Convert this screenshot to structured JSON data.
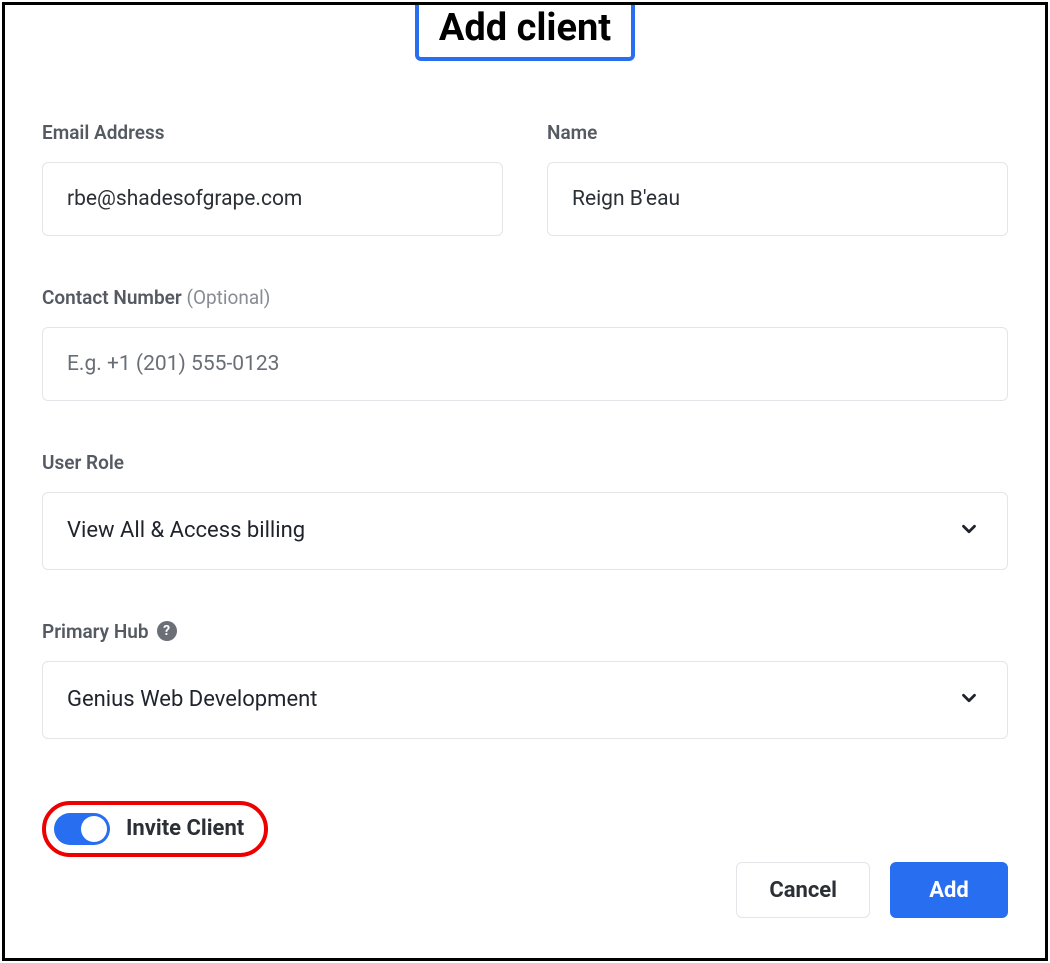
{
  "dialog": {
    "title": "Add client"
  },
  "fields": {
    "email": {
      "label": "Email Address",
      "value": "rbe@shadesofgrape.com"
    },
    "name": {
      "label": "Name",
      "value": "Reign B'eau"
    },
    "contact": {
      "label": "Contact Number",
      "optional": "(Optional)",
      "placeholder": "E.g. +1 (201) 555-0123",
      "value": ""
    },
    "role": {
      "label": "User Role",
      "selected": "View All & Access billing"
    },
    "hub": {
      "label": "Primary Hub",
      "selected": "Genius Web Development"
    }
  },
  "toggle": {
    "label": "Invite Client",
    "on": true
  },
  "actions": {
    "cancel": "Cancel",
    "add": "Add"
  }
}
